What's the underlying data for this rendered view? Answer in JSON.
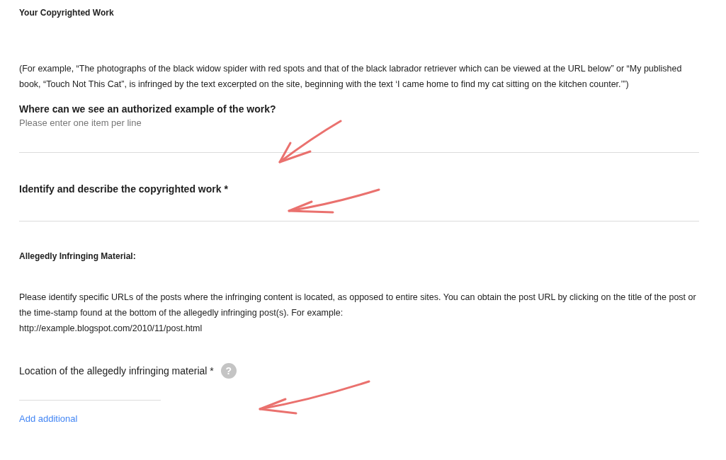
{
  "copyrighted_work": {
    "heading": "Your Copyrighted Work",
    "example": "(For example, “The photographs of the black widow spider with red spots and that of the black labrador retriever which can be viewed at the URL below” or “My published book, “Touch Not This Cat”, is infringed by the text excerpted on the site, beginning with the text ‘I came home to find my cat sitting on the kitchen counter.’”)",
    "fields": [
      {
        "label": "Where can we see an authorized example of the work?",
        "placeholder": "Please enter one item per line"
      },
      {
        "label": "Identify and describe the copyrighted work *"
      }
    ]
  },
  "infringing_material": {
    "heading": "Allegedly Infringing Material:",
    "instructions": "Please identify specific URLs of the posts where the infringing content is located, as opposed to entire sites. You can obtain the post URL by clicking on the title of the post or the time-stamp found at the bottom of the allegedly infringing post(s). For example:",
    "example_url": "http://example.blogspot.com/2010/11/post.html",
    "field": {
      "label": "Location of the allegedly infringing material *",
      "help": "?"
    },
    "add_link": "Add additional"
  }
}
